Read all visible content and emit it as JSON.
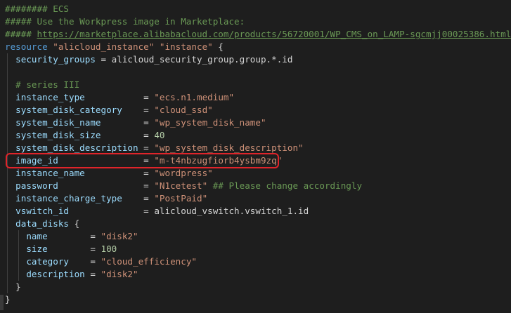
{
  "code": {
    "lines": [
      [
        {
          "t": "######## ECS",
          "c": "comment"
        }
      ],
      [
        {
          "t": "##### Use the Workpress image in Marketplace:",
          "c": "comment"
        }
      ],
      [
        {
          "t": "##### ",
          "c": "comment"
        },
        {
          "t": "https://marketplace.alibabacloud.com/products/56720001/WP_CMS_on_LAMP-sgcmjj00025386.html",
          "c": "link"
        }
      ],
      [
        {
          "t": "resource ",
          "c": "keyword"
        },
        {
          "t": "\"alicloud_instance\" \"instance\"",
          "c": "string"
        },
        {
          "t": " {",
          "c": "plain"
        }
      ],
      [
        {
          "t": "  ",
          "c": "plain"
        },
        {
          "t": "security_groups",
          "c": "prop"
        },
        {
          "t": " = alicloud_security_group.group.*.id",
          "c": "plain"
        }
      ],
      [],
      [
        {
          "t": "  # series III",
          "c": "comment"
        }
      ],
      [
        {
          "t": "  ",
          "c": "plain"
        },
        {
          "t": "instance_type",
          "c": "prop"
        },
        {
          "t": "           = ",
          "c": "plain"
        },
        {
          "t": "\"ecs.n1.medium\"",
          "c": "string"
        }
      ],
      [
        {
          "t": "  ",
          "c": "plain"
        },
        {
          "t": "system_disk_category",
          "c": "prop"
        },
        {
          "t": "    = ",
          "c": "plain"
        },
        {
          "t": "\"cloud_ssd\"",
          "c": "string"
        }
      ],
      [
        {
          "t": "  ",
          "c": "plain"
        },
        {
          "t": "system_disk_name",
          "c": "prop"
        },
        {
          "t": "        = ",
          "c": "plain"
        },
        {
          "t": "\"wp_system_disk_name\"",
          "c": "string"
        }
      ],
      [
        {
          "t": "  ",
          "c": "plain"
        },
        {
          "t": "system_disk_size",
          "c": "prop"
        },
        {
          "t": "        = ",
          "c": "plain"
        },
        {
          "t": "40",
          "c": "number"
        }
      ],
      [
        {
          "t": "  ",
          "c": "plain"
        },
        {
          "t": "system_disk_description",
          "c": "prop"
        },
        {
          "t": " = ",
          "c": "plain"
        },
        {
          "t": "\"wp_system_disk_description\"",
          "c": "string"
        }
      ],
      [
        {
          "t": "  ",
          "c": "plain"
        },
        {
          "t": "image_id",
          "c": "prop"
        },
        {
          "t": "                = ",
          "c": "plain"
        },
        {
          "t": "\"m-t4nbzugfiorb4ysbm9zq\"",
          "c": "string"
        }
      ],
      [
        {
          "t": "  ",
          "c": "plain"
        },
        {
          "t": "instance_name",
          "c": "prop"
        },
        {
          "t": "           = ",
          "c": "plain"
        },
        {
          "t": "\"wordpress\"",
          "c": "string"
        }
      ],
      [
        {
          "t": "  ",
          "c": "plain"
        },
        {
          "t": "password",
          "c": "prop"
        },
        {
          "t": "                = ",
          "c": "plain"
        },
        {
          "t": "\"N1cetest\"",
          "c": "string"
        },
        {
          "t": " ## Please change accordingly",
          "c": "comment"
        }
      ],
      [
        {
          "t": "  ",
          "c": "plain"
        },
        {
          "t": "instance_charge_type",
          "c": "prop"
        },
        {
          "t": "    = ",
          "c": "plain"
        },
        {
          "t": "\"PostPaid\"",
          "c": "string"
        }
      ],
      [
        {
          "t": "  ",
          "c": "plain"
        },
        {
          "t": "vswitch_id",
          "c": "prop"
        },
        {
          "t": "              = alicloud_vswitch.vswitch_1.id",
          "c": "plain"
        }
      ],
      [
        {
          "t": "  ",
          "c": "plain"
        },
        {
          "t": "data_disks",
          "c": "prop"
        },
        {
          "t": " {",
          "c": "plain"
        }
      ],
      [
        {
          "t": "    ",
          "c": "plain"
        },
        {
          "t": "name",
          "c": "prop"
        },
        {
          "t": "        = ",
          "c": "plain"
        },
        {
          "t": "\"disk2\"",
          "c": "string"
        }
      ],
      [
        {
          "t": "    ",
          "c": "plain"
        },
        {
          "t": "size",
          "c": "prop"
        },
        {
          "t": "        = ",
          "c": "plain"
        },
        {
          "t": "100",
          "c": "number"
        }
      ],
      [
        {
          "t": "    ",
          "c": "plain"
        },
        {
          "t": "category",
          "c": "prop"
        },
        {
          "t": "    = ",
          "c": "plain"
        },
        {
          "t": "\"cloud_efficiency\"",
          "c": "string"
        }
      ],
      [
        {
          "t": "    ",
          "c": "plain"
        },
        {
          "t": "description",
          "c": "prop"
        },
        {
          "t": " = ",
          "c": "plain"
        },
        {
          "t": "\"disk2\"",
          "c": "string"
        }
      ],
      [
        {
          "t": "  }",
          "c": "plain"
        }
      ],
      [
        {
          "t": "}",
          "c": "plain"
        }
      ]
    ],
    "highlighted_line": 12
  },
  "colors": {
    "background": "#1e1e1e",
    "comment": "#6a9955",
    "keyword": "#569cd6",
    "string": "#ce9178",
    "number": "#b5cea8",
    "property": "#9cdcfe",
    "highlight_border": "#e0242a"
  }
}
